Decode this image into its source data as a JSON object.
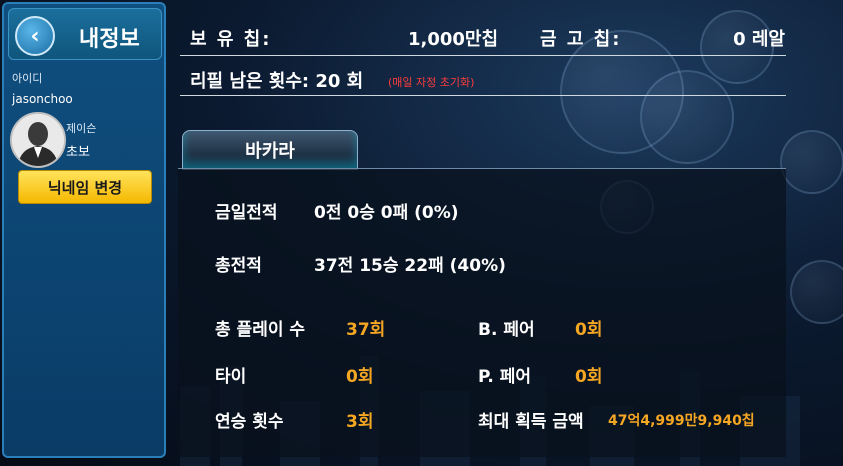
{
  "sidebar": {
    "title": "내정보",
    "back_icon": "chevron-left-icon",
    "id_label": "아이디",
    "id_value": "jasonchoo",
    "nickname": "제이슨",
    "grade": "초보",
    "change_nick_label": "닉네임 변경"
  },
  "top": {
    "chips_label": "보 유 칩:",
    "chips_value": "1,000만칩",
    "vault_label": "금 고 칩:",
    "vault_value": "0 레알",
    "refill_label": "리필 남은 횟수: 20 회",
    "refill_note": "(매일 자정 초기화)"
  },
  "tab": {
    "label": "바카라"
  },
  "stats": {
    "today_label": "금일전적",
    "today_value": "0전 0승 0패 (0%)",
    "total_label": "총전적",
    "total_value": "37전 15승 22패 (40%)",
    "plays_label": "총 플레이 수",
    "plays_value": "37회",
    "bpair_label": "B. 페어",
    "bpair_value": "0회",
    "tie_label": "타이",
    "tie_value": "0회",
    "ppair_label": "P. 페어",
    "ppair_value": "0회",
    "streak_label": "연승 횟수",
    "streak_value": "3회",
    "maxwin_label": "최대 획득 금액",
    "maxwin_value": "47억4,999만9,940칩"
  },
  "colors": {
    "accent_gold": "#f5a623",
    "button_yellow": "#f5b800",
    "note_red": "#ff3b3b"
  }
}
